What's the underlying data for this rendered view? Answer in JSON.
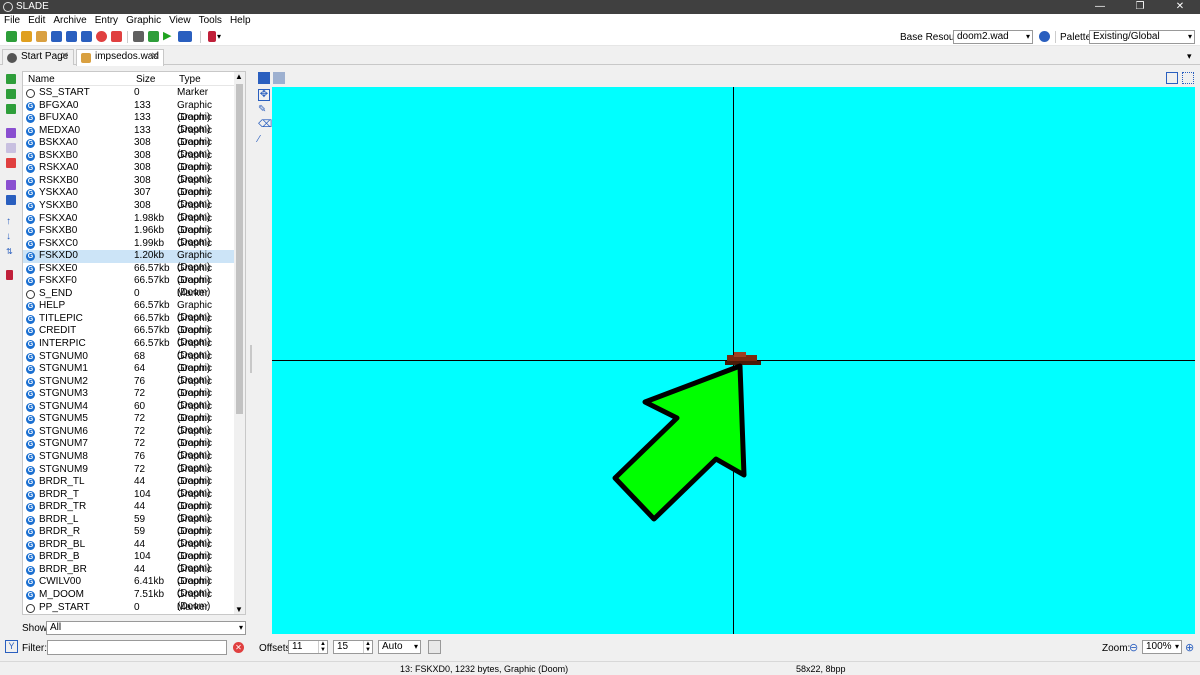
{
  "window": {
    "title": "SLADE"
  },
  "menu": [
    "File",
    "Edit",
    "Archive",
    "Entry",
    "Graphic",
    "View",
    "Tools",
    "Help"
  ],
  "toolbar": {
    "base_resource_label": "Base Resource:",
    "base_resource_value": "doom2.wad",
    "palette_label": "Palette:",
    "palette_value": "Existing/Global"
  },
  "tabs": [
    {
      "label": "Start Page"
    },
    {
      "label": "impsedos.wad"
    }
  ],
  "entry_list": {
    "columns": {
      "name": "Name",
      "size": "Size",
      "type": "Type"
    },
    "rows": [
      {
        "name": "SS_START",
        "size": "0",
        "type": "Marker",
        "icon": "marker-icon"
      },
      {
        "name": "BFGXA0",
        "size": "133",
        "type": "Graphic (Doom)",
        "icon": "graphic-icon"
      },
      {
        "name": "BFUXA0",
        "size": "133",
        "type": "Graphic (Doom)",
        "icon": "graphic-icon"
      },
      {
        "name": "MEDXA0",
        "size": "133",
        "type": "Graphic (Doom)",
        "icon": "graphic-icon"
      },
      {
        "name": "BSKXA0",
        "size": "308",
        "type": "Graphic (Doom)",
        "icon": "graphic-icon"
      },
      {
        "name": "BSKXB0",
        "size": "308",
        "type": "Graphic (Doom)",
        "icon": "graphic-icon"
      },
      {
        "name": "RSKXA0",
        "size": "308",
        "type": "Graphic (Doom)",
        "icon": "graphic-icon"
      },
      {
        "name": "RSKXB0",
        "size": "308",
        "type": "Graphic (Doom)",
        "icon": "graphic-icon"
      },
      {
        "name": "YSKXA0",
        "size": "307",
        "type": "Graphic (Doom)",
        "icon": "graphic-icon"
      },
      {
        "name": "YSKXB0",
        "size": "308",
        "type": "Graphic (Doom)",
        "icon": "graphic-icon"
      },
      {
        "name": "FSKXA0",
        "size": "1.98kb",
        "type": "Graphic (Doom)",
        "icon": "graphic-icon"
      },
      {
        "name": "FSKXB0",
        "size": "1.96kb",
        "type": "Graphic (Doom)",
        "icon": "graphic-icon"
      },
      {
        "name": "FSKXC0",
        "size": "1.99kb",
        "type": "Graphic (Doom)",
        "icon": "graphic-icon"
      },
      {
        "name": "FSKXD0",
        "size": "1.20kb",
        "type": "Graphic (Doom)",
        "icon": "graphic-icon",
        "selected": true
      },
      {
        "name": "FSKXE0",
        "size": "66.57kb",
        "type": "Graphic (Doom)",
        "icon": "graphic-icon"
      },
      {
        "name": "FSKXF0",
        "size": "66.57kb",
        "type": "Graphic (Doom)",
        "icon": "graphic-icon"
      },
      {
        "name": "S_END",
        "size": "0",
        "type": "Marker",
        "icon": "marker-icon"
      },
      {
        "name": "HELP",
        "size": "66.57kb",
        "type": "Graphic (Doom)",
        "icon": "graphic-icon"
      },
      {
        "name": "TITLEPIC",
        "size": "66.57kb",
        "type": "Graphic (Doom)",
        "icon": "graphic-icon"
      },
      {
        "name": "CREDIT",
        "size": "66.57kb",
        "type": "Graphic (Doom)",
        "icon": "graphic-icon"
      },
      {
        "name": "INTERPIC",
        "size": "66.57kb",
        "type": "Graphic (Doom)",
        "icon": "graphic-icon"
      },
      {
        "name": "STGNUM0",
        "size": "68",
        "type": "Graphic (Doom)",
        "icon": "graphic-icon"
      },
      {
        "name": "STGNUM1",
        "size": "64",
        "type": "Graphic (Doom)",
        "icon": "graphic-icon"
      },
      {
        "name": "STGNUM2",
        "size": "76",
        "type": "Graphic (Doom)",
        "icon": "graphic-icon"
      },
      {
        "name": "STGNUM3",
        "size": "72",
        "type": "Graphic (Doom)",
        "icon": "graphic-icon"
      },
      {
        "name": "STGNUM4",
        "size": "60",
        "type": "Graphic (Doom)",
        "icon": "graphic-icon"
      },
      {
        "name": "STGNUM5",
        "size": "72",
        "type": "Graphic (Doom)",
        "icon": "graphic-icon"
      },
      {
        "name": "STGNUM6",
        "size": "72",
        "type": "Graphic (Doom)",
        "icon": "graphic-icon"
      },
      {
        "name": "STGNUM7",
        "size": "72",
        "type": "Graphic (Doom)",
        "icon": "graphic-icon"
      },
      {
        "name": "STGNUM8",
        "size": "76",
        "type": "Graphic (Doom)",
        "icon": "graphic-icon"
      },
      {
        "name": "STGNUM9",
        "size": "72",
        "type": "Graphic (Doom)",
        "icon": "graphic-icon"
      },
      {
        "name": "BRDR_TL",
        "size": "44",
        "type": "Graphic (Doom)",
        "icon": "graphic-icon"
      },
      {
        "name": "BRDR_T",
        "size": "104",
        "type": "Graphic (Doom)",
        "icon": "graphic-icon"
      },
      {
        "name": "BRDR_TR",
        "size": "44",
        "type": "Graphic (Doom)",
        "icon": "graphic-icon"
      },
      {
        "name": "BRDR_L",
        "size": "59",
        "type": "Graphic (Doom)",
        "icon": "graphic-icon"
      },
      {
        "name": "BRDR_R",
        "size": "59",
        "type": "Graphic (Doom)",
        "icon": "graphic-icon"
      },
      {
        "name": "BRDR_BL",
        "size": "44",
        "type": "Graphic (Doom)",
        "icon": "graphic-icon"
      },
      {
        "name": "BRDR_B",
        "size": "104",
        "type": "Graphic (Doom)",
        "icon": "graphic-icon"
      },
      {
        "name": "BRDR_BR",
        "size": "44",
        "type": "Graphic (Doom)",
        "icon": "graphic-icon"
      },
      {
        "name": "CWILV00",
        "size": "6.41kb",
        "type": "Graphic (Doom)",
        "icon": "graphic-icon"
      },
      {
        "name": "M_DOOM",
        "size": "7.51kb",
        "type": "Graphic (Doom)",
        "icon": "graphic-icon"
      },
      {
        "name": "PP_START",
        "size": "0",
        "type": "Marker",
        "icon": "marker-icon"
      }
    ]
  },
  "show": {
    "label": "Show:",
    "value": "All"
  },
  "filter": {
    "label": "Filter:",
    "value": ""
  },
  "offsets": {
    "label": "Offsets:",
    "x": "11",
    "y": "15",
    "mode": "Auto"
  },
  "zoom": {
    "label": "Zoom:",
    "value": "100%"
  },
  "status": {
    "entry_info": "13: FSKXD0, 1232 bytes, Graphic (Doom)",
    "image_info": "58x22, 8bpp"
  },
  "colors": {
    "canvas": "#00ffff",
    "arrow": "#00ff00",
    "selection": "#cce4f7"
  }
}
